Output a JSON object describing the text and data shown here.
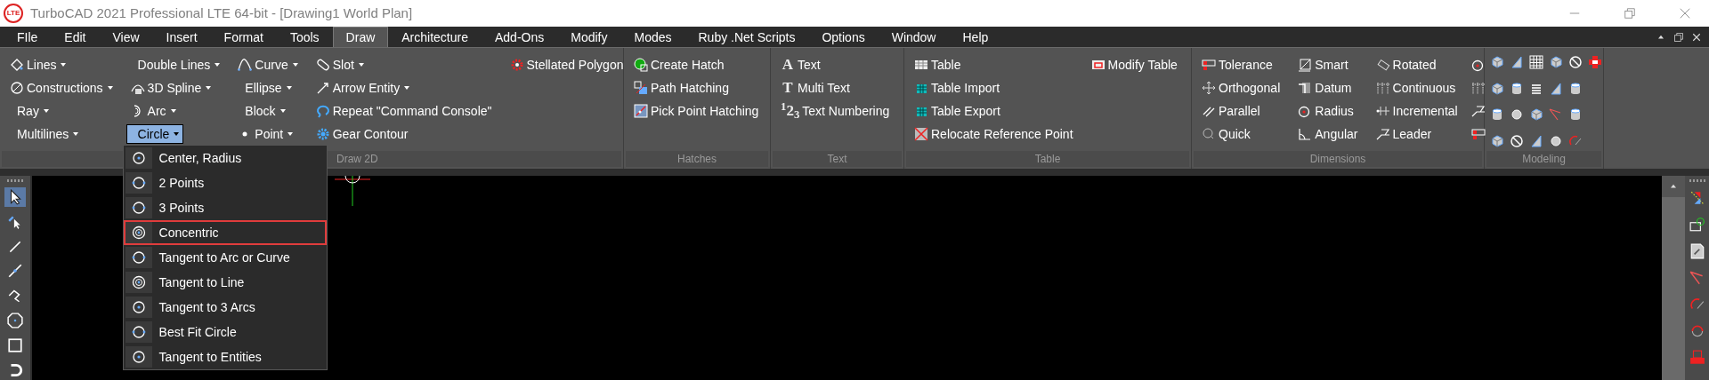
{
  "window": {
    "logo_text": "LTE",
    "title": "TurboCAD 2021 Professional LTE 64-bit - [Drawing1 World Plan]"
  },
  "menu": [
    {
      "label": "FIle",
      "selected": false
    },
    {
      "label": "Edit",
      "selected": false
    },
    {
      "label": "View",
      "selected": false
    },
    {
      "label": "Insert",
      "selected": false
    },
    {
      "label": "Format",
      "selected": false
    },
    {
      "label": "Tools",
      "selected": false
    },
    {
      "label": "Draw",
      "selected": true
    },
    {
      "label": "Architecture",
      "selected": false
    },
    {
      "label": "Add-Ons",
      "selected": false
    },
    {
      "label": "Modify",
      "selected": false
    },
    {
      "label": "Modes",
      "selected": false
    },
    {
      "label": "Ruby .Net Scripts",
      "selected": false
    },
    {
      "label": "Options",
      "selected": false
    },
    {
      "label": "Window",
      "selected": false
    },
    {
      "label": "Help",
      "selected": false
    }
  ],
  "ribbon": {
    "groups": [
      {
        "label": "Draw 2D",
        "kind": "commands",
        "columns": [
          [
            {
              "label": "Lines",
              "dropdown": true
            },
            {
              "label": "Constructions",
              "dropdown": true
            },
            {
              "label": "Ray",
              "dropdown": true
            },
            {
              "label": "Multilines",
              "dropdown": true
            }
          ],
          [
            {
              "label": "Double Lines",
              "dropdown": true
            },
            {
              "label": "3D Spline",
              "dropdown": true
            },
            {
              "label": "Arc",
              "dropdown": true
            },
            {
              "label": "Circle",
              "dropdown": true,
              "expanded": true,
              "menu": [
                {
                  "label": "Center, Radius",
                  "selected": false
                },
                {
                  "label": "2 Points",
                  "selected": false
                },
                {
                  "label": "3 Points",
                  "selected": false
                },
                {
                  "label": "Concentric",
                  "selected": true
                },
                {
                  "label": "Tangent to Arc or Curve",
                  "selected": false
                },
                {
                  "label": "Tangent to Line",
                  "selected": false
                },
                {
                  "label": "Tangent to 3 Arcs",
                  "selected": false
                },
                {
                  "label": "Best Fit Circle",
                  "selected": false
                },
                {
                  "label": "Tangent to Entities",
                  "selected": false
                }
              ]
            }
          ],
          [
            {
              "label": "Curve",
              "dropdown": true
            },
            {
              "label": "Ellipse",
              "dropdown": true
            },
            {
              "label": "Block",
              "dropdown": true
            },
            {
              "label": "Point",
              "dropdown": true
            }
          ],
          [
            {
              "label": "Slot",
              "dropdown": true
            },
            {
              "label": "Arrow Entity",
              "dropdown": true
            },
            {
              "label": "Repeat \"Command Console\"",
              "dropdown": false
            },
            {
              "label": "Gear Contour",
              "dropdown": false
            }
          ],
          [
            {
              "label": "Stellated Polygon",
              "dropdown": false
            }
          ]
        ]
      },
      {
        "label": "Hatches",
        "kind": "commands",
        "columns": [
          [
            {
              "label": "Create Hatch",
              "dropdown": false
            },
            {
              "label": "Path Hatching",
              "dropdown": false
            },
            {
              "label": "Pick Point Hatching",
              "dropdown": false
            }
          ]
        ]
      },
      {
        "label": "Text",
        "kind": "commands",
        "columns": [
          [
            {
              "label": "Text",
              "dropdown": false,
              "glyph": "A"
            },
            {
              "label": "Multi Text",
              "dropdown": false,
              "glyph": "T"
            },
            {
              "label": "Text Numbering",
              "dropdown": false,
              "glyph": "$^{1}$2$_{3}$"
            }
          ]
        ]
      },
      {
        "label": "Table",
        "kind": "commands",
        "columns": [
          [
            {
              "label": "Table",
              "dropdown": false
            },
            {
              "label": "Table Import",
              "dropdown": false
            },
            {
              "label": "Table Export",
              "dropdown": false
            },
            {
              "label": "Relocate Reference Point",
              "dropdown": false
            }
          ],
          [
            {
              "label": "Modify Table",
              "dropdown": false
            }
          ]
        ]
      },
      {
        "label": "Dimensions",
        "kind": "commands",
        "columns": [
          [
            {
              "label": "Tolerance",
              "dropdown": false
            },
            {
              "label": "Orthogonal",
              "dropdown": false
            },
            {
              "label": "Parallel",
              "dropdown": false
            },
            {
              "label": "Quick",
              "dropdown": false
            }
          ],
          [
            {
              "label": "Smart",
              "dropdown": false
            },
            {
              "label": "Datum",
              "dropdown": false
            },
            {
              "label": "Radius",
              "dropdown": false
            },
            {
              "label": "Angular",
              "dropdown": false
            }
          ],
          [
            {
              "label": "Rotated",
              "dropdown": false
            },
            {
              "label": "Continuous",
              "dropdown": false
            },
            {
              "label": "Incremental",
              "dropdown": false
            },
            {
              "label": "Leader",
              "dropdown": false
            }
          ]
        ]
      },
      {
        "label": "Modeling",
        "kind": "icons"
      }
    ]
  }
}
